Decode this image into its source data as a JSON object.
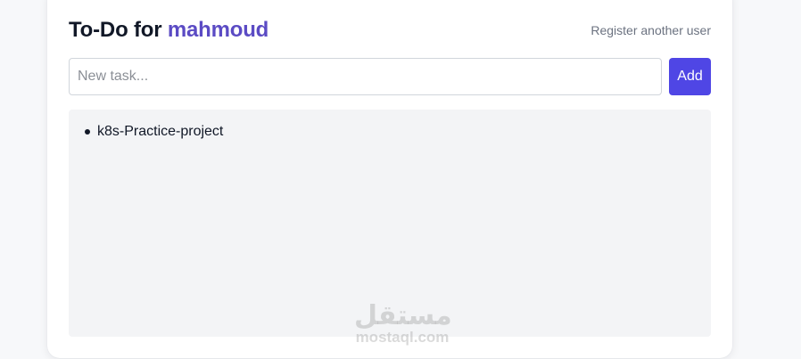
{
  "header": {
    "title_prefix": "To-Do for",
    "username": "mahmoud",
    "register_link": "Register another user"
  },
  "form": {
    "placeholder": "New task...",
    "value": "",
    "add_label": "Add"
  },
  "tasks": [
    {
      "text": "k8s-Practice-project"
    }
  ],
  "watermark": {
    "arabic": "مستقل",
    "latin": "mostaql.com"
  },
  "colors": {
    "accent": "#4f46e5",
    "username": "#5b4bc4",
    "panel": "#f3f4f6"
  }
}
